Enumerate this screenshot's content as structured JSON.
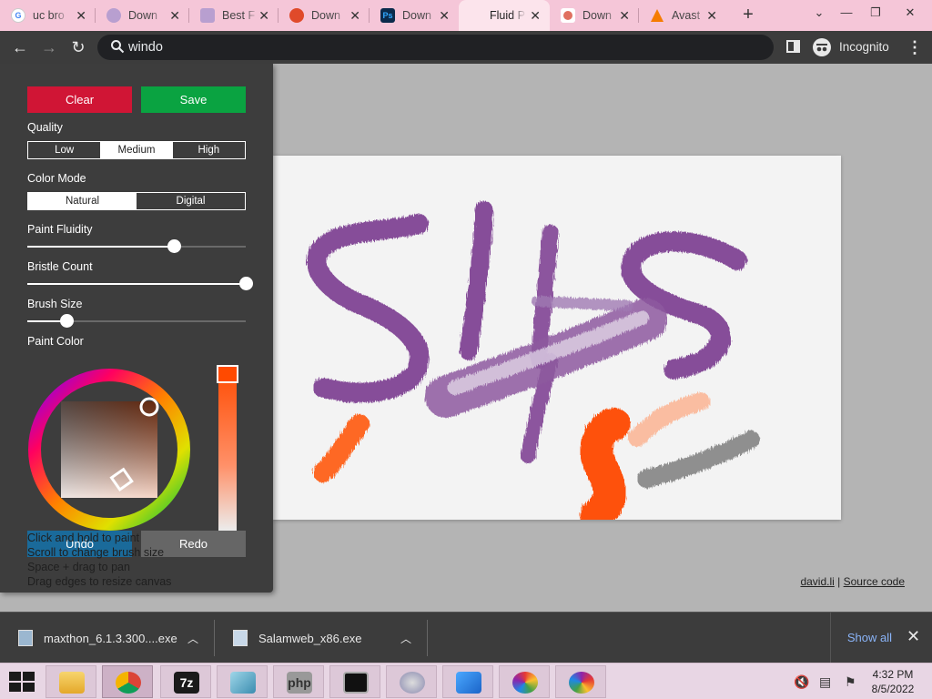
{
  "browser": {
    "tabs": [
      {
        "title": "uc bro",
        "favicon": "google-icon",
        "color": "#4285f4",
        "active": false
      },
      {
        "title": "Down",
        "favicon": "download-site-icon",
        "color": "#b89fd0",
        "active": false
      },
      {
        "title": "Best F",
        "favicon": "generic-site-icon",
        "color": "#b89fd0",
        "active": false
      },
      {
        "title": "Down",
        "favicon": "softonic-icon",
        "color": "#e04a2a",
        "active": false
      },
      {
        "title": "Down",
        "favicon": "photoshop-icon",
        "color": "#0b2b4c",
        "active": false
      },
      {
        "title": "Fluid P",
        "favicon": "",
        "color": "",
        "active": true
      },
      {
        "title": "Down",
        "favicon": "download-icon",
        "color": "#e07060",
        "active": false
      },
      {
        "title": "Avast",
        "favicon": "avast-icon",
        "color": "#f57c00",
        "active": false
      }
    ],
    "address": "windo",
    "incognito_label": "Incognito"
  },
  "panel": {
    "clear": "Clear",
    "save": "Save",
    "quality": {
      "label": "Quality",
      "options": [
        "Low",
        "Medium",
        "High"
      ],
      "selected": "Medium"
    },
    "color_mode": {
      "label": "Color Mode",
      "options": [
        "Natural",
        "Digital"
      ],
      "selected": "Natural"
    },
    "fluidity": {
      "label": "Paint Fluidity",
      "value": 0.67
    },
    "bristles": {
      "label": "Bristle Count",
      "value": 1.0
    },
    "brush": {
      "label": "Brush Size",
      "value": 0.18
    },
    "paint_color": {
      "label": "Paint Color",
      "hex": "#ff4a00"
    },
    "undo": "Undo",
    "redo": "Redo",
    "help": [
      "Click and hold to paint",
      "Scroll to change brush size",
      "Space + drag to pan",
      "Drag edges to resize canvas"
    ]
  },
  "footer": {
    "author": "david.li",
    "separator": "|",
    "source": "Source code"
  },
  "downloads": {
    "items": [
      {
        "name": "maxthon_6.1.3.300....exe"
      },
      {
        "name": "Salamweb_x86.exe"
      }
    ],
    "show_all": "Show all"
  },
  "taskbar": {
    "time": "4:32 PM",
    "date": "8/5/2022"
  },
  "colors": {
    "clear": "#d01535",
    "save": "#0aa341",
    "purple_paint": "#7a3a8f",
    "orange_paint": "#ff4a00",
    "gray_paint": "#777777"
  }
}
